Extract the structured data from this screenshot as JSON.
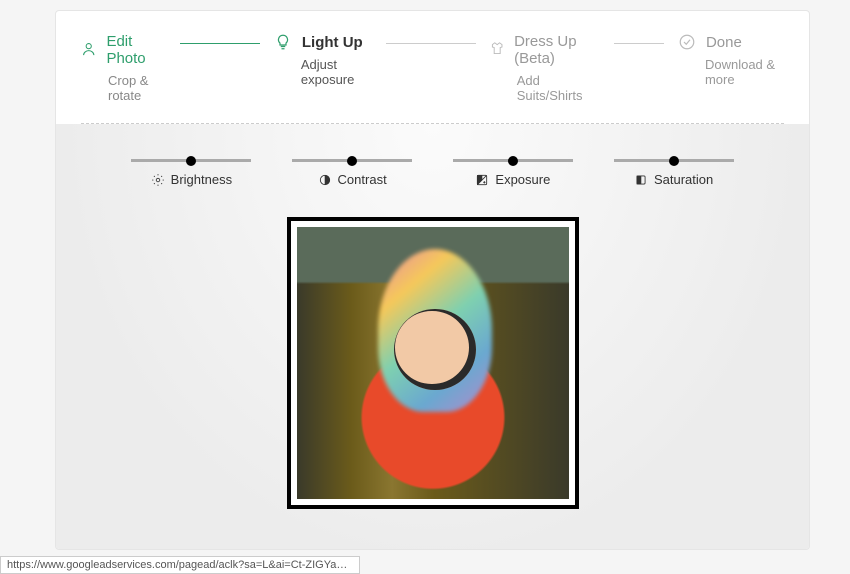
{
  "steps": [
    {
      "title": "Edit Photo",
      "subtitle": "Crop & rotate",
      "icon": "person-icon",
      "state": "done"
    },
    {
      "title": "Light Up",
      "subtitle": "Adjust exposure",
      "icon": "bulb-icon",
      "state": "active"
    },
    {
      "title": "Dress Up (Beta)",
      "subtitle": "Add Suits/Shirts",
      "icon": "shirt-icon",
      "state": "pending"
    },
    {
      "title": "Done",
      "subtitle": "Download & more",
      "icon": "check-circle-icon",
      "state": "pending"
    }
  ],
  "sliders": [
    {
      "label": "Brightness",
      "icon": "sun-icon",
      "value": 50
    },
    {
      "label": "Contrast",
      "icon": "contrast-icon",
      "value": 50
    },
    {
      "label": "Exposure",
      "icon": "exposure-icon",
      "value": 50
    },
    {
      "label": "Saturation",
      "icon": "saturation-icon",
      "value": 50
    }
  ],
  "statusbar": "https://www.googleadservices.com/pagead/aclk?sa=L&ai=Ct-ZIGYaWXoqRLY2T8..."
}
